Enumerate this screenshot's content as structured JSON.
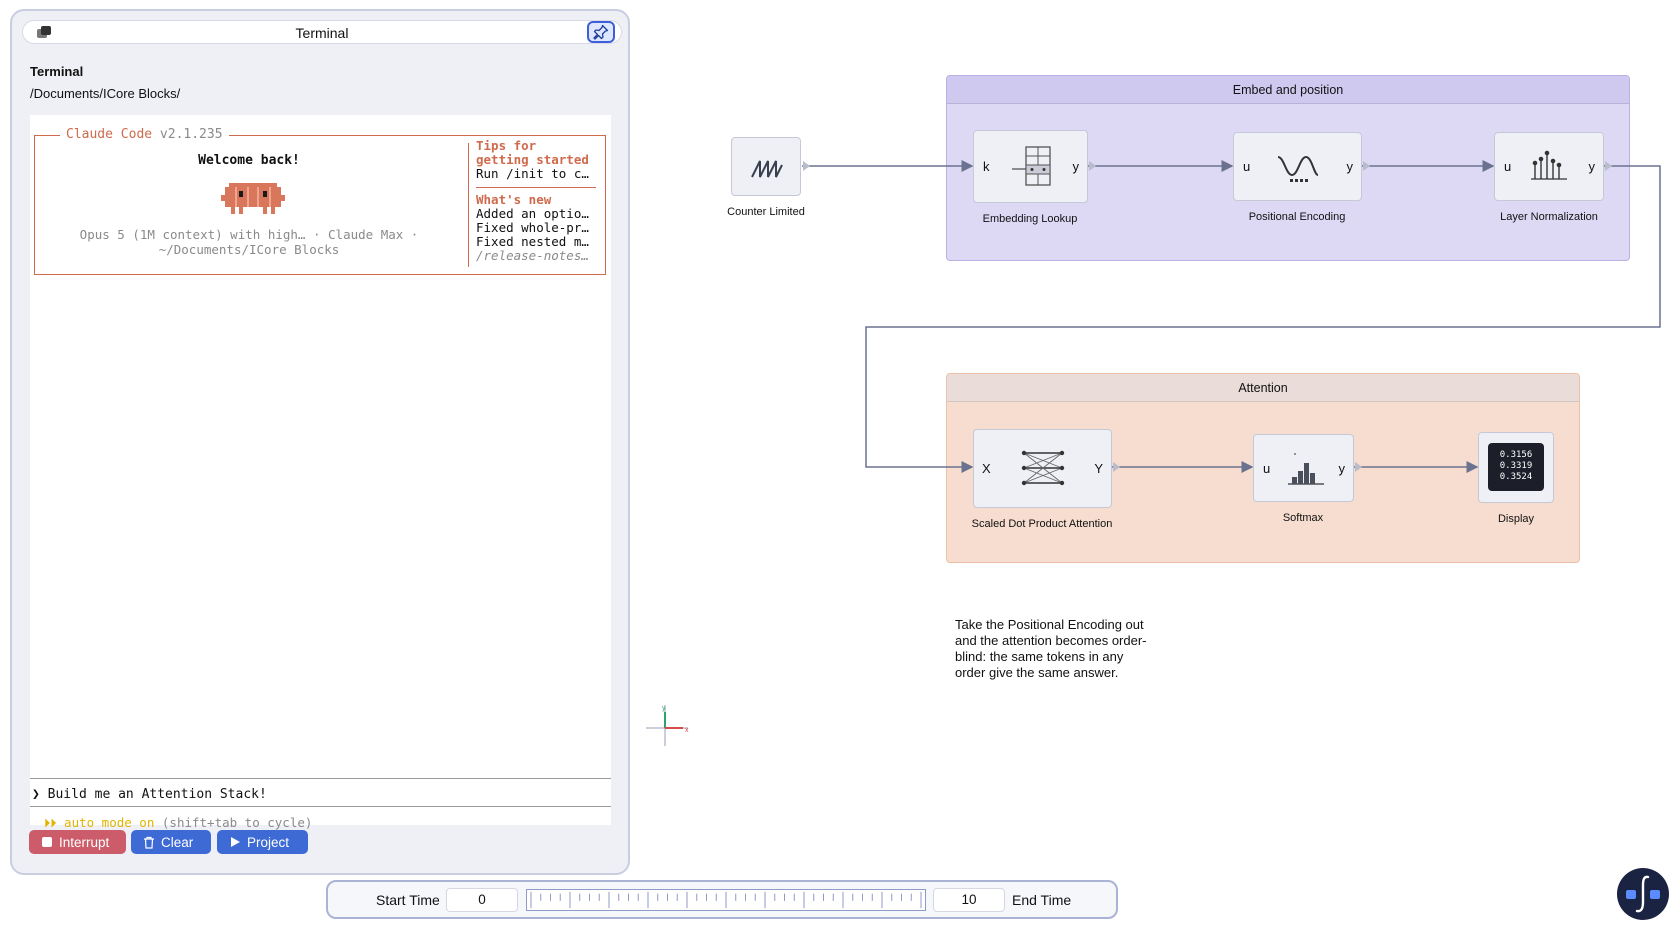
{
  "terminal_panel": {
    "window_title": "Terminal",
    "heading": "Terminal",
    "path": "/Documents/ICore Blocks/",
    "claude_box": {
      "legend_name": "Claude Code",
      "legend_version": "v2.1.235",
      "welcome": "Welcome back!",
      "info_line1": "Opus 5 (1M context) with high… · Claude Max ·",
      "info_line2": "~/Documents/ICore Blocks",
      "tips_heading_1": "Tips for",
      "tips_heading_2": "getting started",
      "tips_line": "Run /init to c…",
      "whats_new_heading": "What's new",
      "whats_new_items": [
        "Added an optio…",
        "Fixed whole-pr…",
        "Fixed nested m…"
      ],
      "release_notes": "/release-notes…"
    },
    "prompt_symbol": "❯",
    "prompt_text": "Build me an Attention Stack!",
    "mode_arrows": "⏵⏵",
    "mode_text": "auto mode on",
    "mode_hint": "(shift+tab to cycle)",
    "buttons": {
      "interrupt": "Interrupt",
      "clear": "Clear",
      "project": "Project"
    }
  },
  "diagram": {
    "source_block": {
      "label": "Counter Limited",
      "icon": "sawtooth-icon"
    },
    "groups": {
      "embed": {
        "title": "Embed and position",
        "blocks": [
          {
            "label": "Embedding Lookup",
            "in_port": "k",
            "out_port": "y",
            "icon": "table-lookup-icon"
          },
          {
            "label": "Positional Encoding",
            "in_port": "u",
            "out_port": "y",
            "icon": "sine-wave-icon"
          },
          {
            "label": "Layer Normalization",
            "in_port": "u",
            "out_port": "y",
            "icon": "stem-plot-icon"
          }
        ]
      },
      "attention": {
        "title": "Attention",
        "blocks": [
          {
            "label": "Scaled Dot Product Attention",
            "in_port": "X",
            "out_port": "Y",
            "icon": "attention-graph-icon"
          },
          {
            "label": "Softmax",
            "in_port": "u",
            "out_port": "y",
            "icon": "bar-chart-icon"
          },
          {
            "label": "Display",
            "values": [
              "0.3156",
              "0.3319",
              "0.3524"
            ]
          }
        ]
      }
    },
    "note": "Take the Positional Encoding out and the attention becomes order-blind: the same tokens in any order give the same answer.",
    "axis_labels": {
      "x": "x",
      "y": "y"
    }
  },
  "timebar": {
    "start_label": "Start Time",
    "start_value": "0",
    "end_value": "10",
    "end_label": "End Time"
  },
  "colors": {
    "accent_blue": "#3e6ad6",
    "interrupt_red": "#cc5c6a",
    "claude_orange": "#d06a4c",
    "embed_group": "#ddd9f5",
    "attention_group": "#f6ddcf"
  }
}
